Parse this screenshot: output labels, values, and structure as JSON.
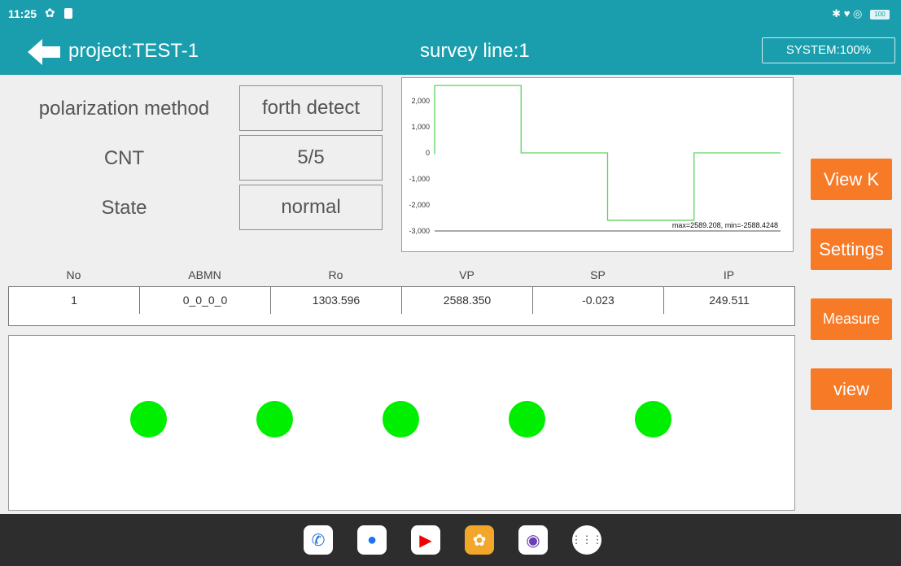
{
  "status_bar": {
    "time": "11:25",
    "battery": "100"
  },
  "header": {
    "project": "project:TEST-1",
    "survey_line": "survey line:1",
    "system": "SYSTEM:100%"
  },
  "info": [
    {
      "label": "polarization method",
      "value": "forth detect"
    },
    {
      "label": "CNT",
      "value": "5/5"
    },
    {
      "label": "State",
      "value": "normal"
    }
  ],
  "chart_data": {
    "type": "line",
    "y_ticks": [
      "2,000",
      "1,000",
      "0",
      "-1,000",
      "-2,000",
      "-3,000"
    ],
    "ylim": [
      -3000,
      2500
    ],
    "annotation": "max=2589.208, min=-2588.4248",
    "series": [
      {
        "color": "#5fd35f",
        "points": [
          [
            0,
            -50
          ],
          [
            0,
            2589
          ],
          [
            25,
            2589
          ],
          [
            25,
            0
          ],
          [
            50,
            0
          ],
          [
            50,
            -2588
          ],
          [
            75,
            -2588
          ],
          [
            75,
            0
          ],
          [
            100,
            0
          ]
        ]
      }
    ]
  },
  "side_buttons": [
    "View K",
    "Settings",
    "Measure",
    "view"
  ],
  "table": {
    "headers": [
      "No",
      "ABMN",
      "Ro",
      "VP",
      "SP",
      "IP"
    ],
    "rows": [
      [
        "1",
        "0_0_0_0",
        "1303.596",
        "2588.350",
        "-0.023",
        "249.511"
      ]
    ]
  },
  "electrodes": {
    "count": 5,
    "color": "#00ee00"
  },
  "dock": [
    "phone-icon",
    "messages-icon",
    "youtube-icon",
    "settings-icon",
    "camera-icon",
    "apps-icon"
  ]
}
